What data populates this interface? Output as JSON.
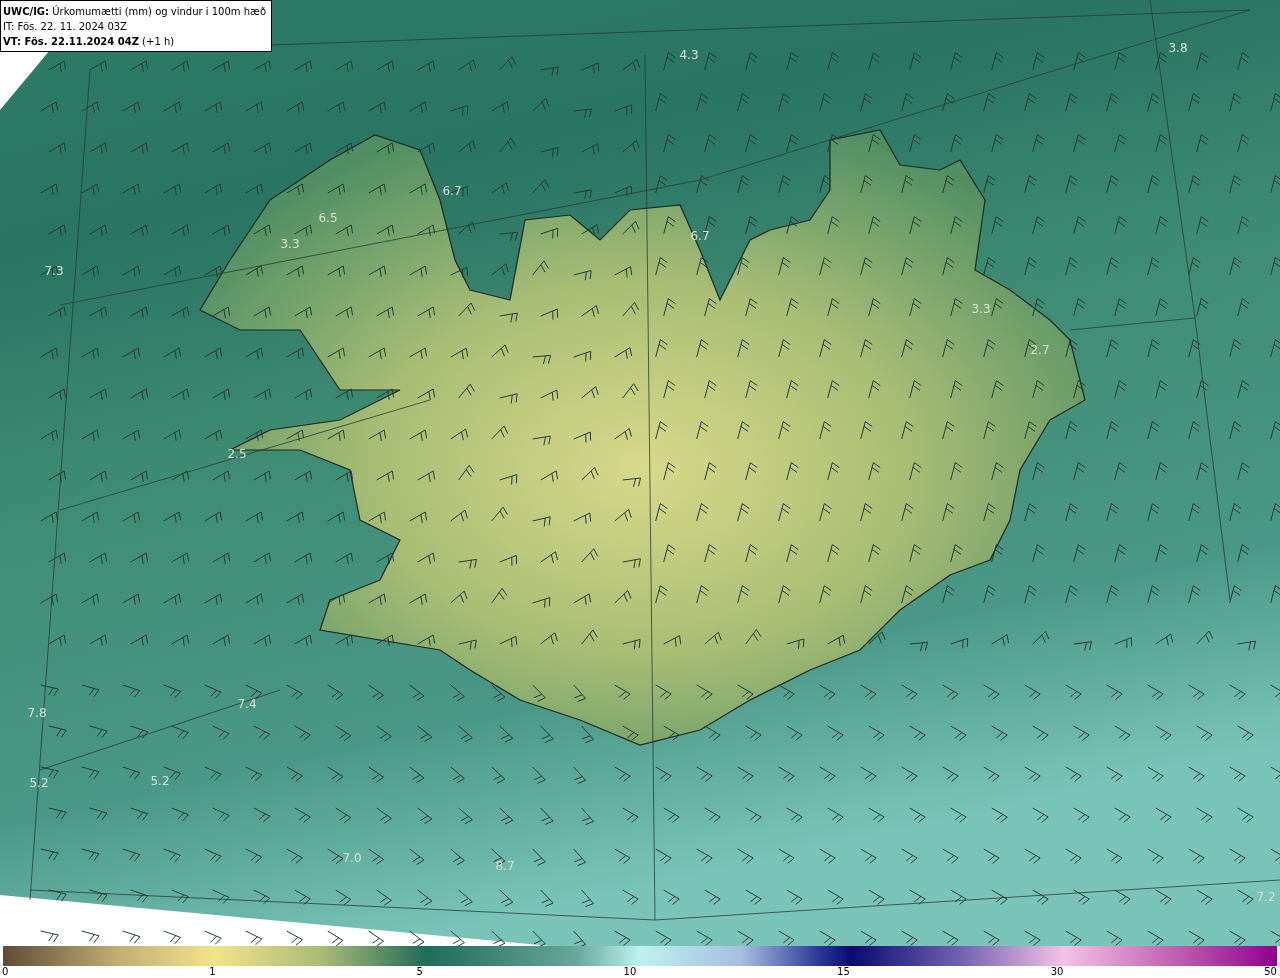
{
  "title_box": {
    "heading": "**UWC/IG:** Úrkomumætti (mm) og vindur i 100m hæð",
    "issue_time": "IT: Fös. 22. 11. 2024 03Z",
    "valid_time": "**VT: Fös. 22.11.2024 04Z** (+1 h)"
  },
  "map": {
    "value_labels": [
      "4.3",
      "3.8",
      "6.7",
      "6.5",
      "3.3",
      "7.3",
      "6.7",
      "3.3",
      "2.7",
      "2.5",
      "7.8",
      "7.4",
      "5.2",
      "5.2",
      "7.0",
      "8.7",
      "7.2"
    ]
  },
  "colorbar": {
    "ticks": [
      "0",
      "1",
      "5",
      "10",
      "15",
      "30",
      "50"
    ]
  }
}
